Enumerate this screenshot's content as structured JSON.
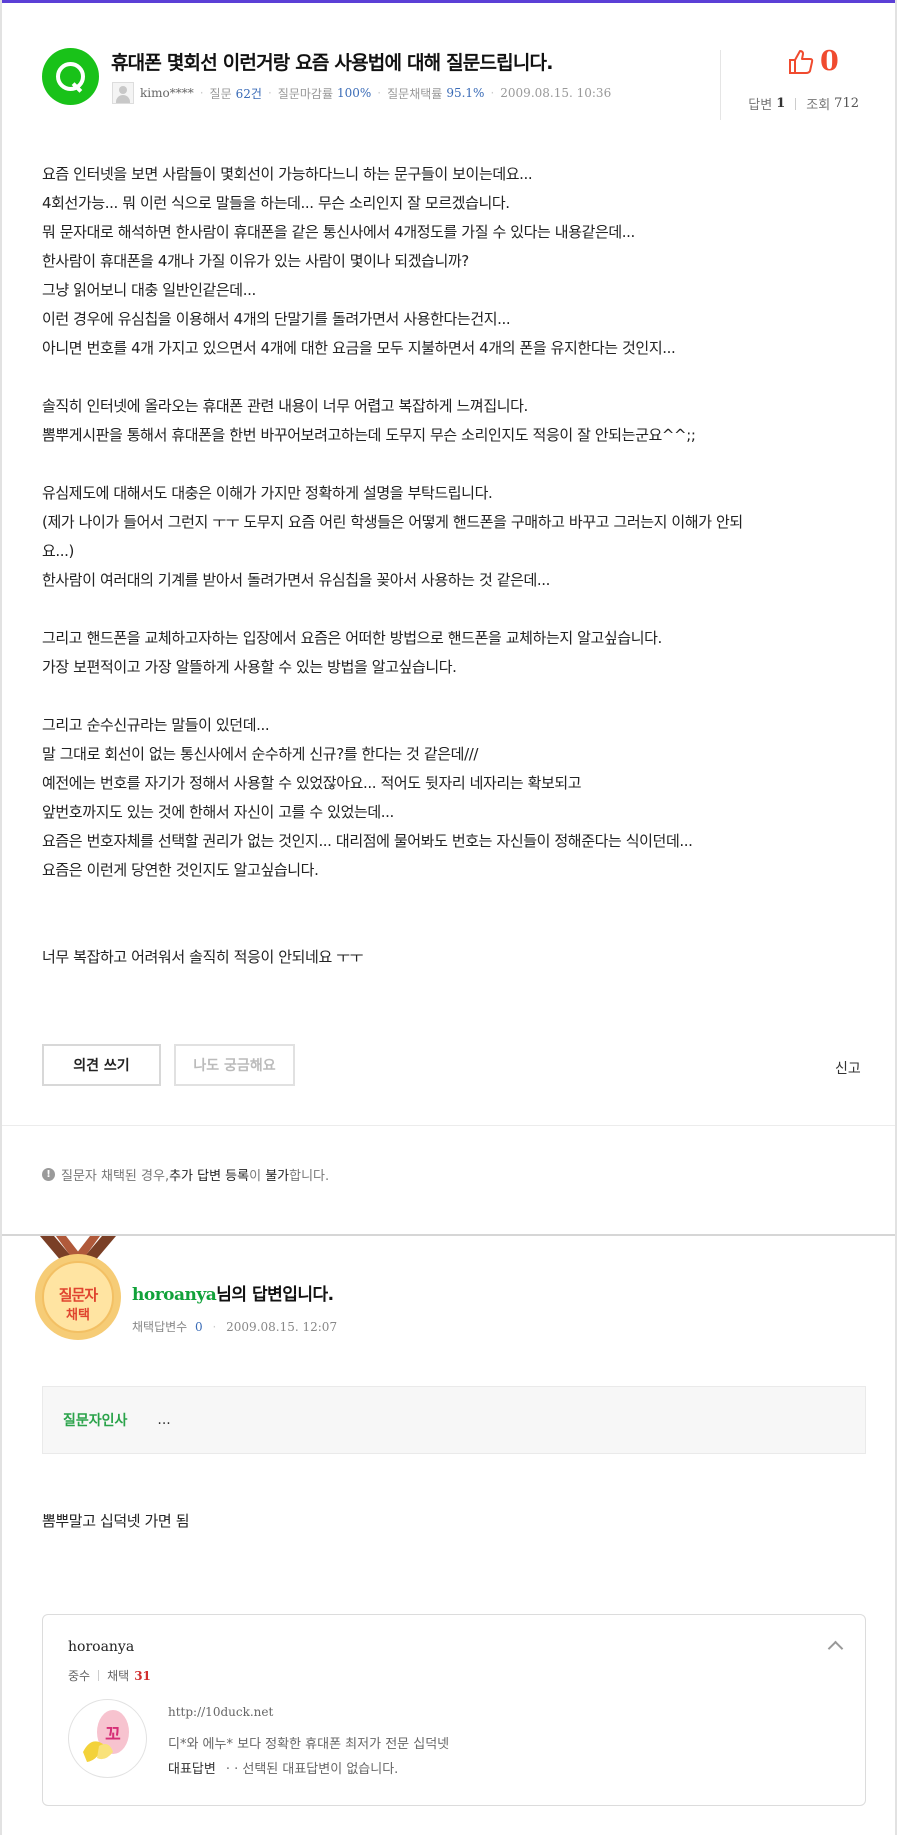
{
  "colors": {
    "accent_bar": "#5b3fd6",
    "like_red": "#f04b2f",
    "user_green": "#11a23a",
    "value_blue": "#3b6cb7"
  },
  "question": {
    "badge_icon": "q-icon",
    "title": "휴대폰 몇회선 이런거랑 요즘 사용법에 대해 질문드립니다.",
    "author": "kimo****",
    "meta": [
      {
        "label": "질문",
        "value": "62건"
      },
      {
        "label": "질문마감률",
        "value": "100%"
      },
      {
        "label": "질문채택률",
        "value": "95.1%"
      }
    ],
    "date": "2009.08.15. 10:36",
    "likes": "0",
    "answers_label": "답변",
    "answers_count": "1",
    "views_label": "조회",
    "views_count": "712",
    "body": [
      "요즘 인터넷을 보면 사람들이 몇회선이 가능하다느니 하는 문구들이 보이는데요...",
      "4회선가능... 뭐 이런 식으로 말들을 하는데... 무슨 소리인지 잘 모르겠습니다.",
      "뭐 문자대로 해석하면 한사람이 휴대폰을 같은 통신사에서 4개정도를 가질 수 있다는 내용같은데...",
      "한사람이 휴대폰을 4개나 가질 이유가 있는 사람이 몇이나 되겠습니까?",
      "그냥 읽어보니 대충 일반인같은데...",
      "이런 경우에 유심칩을 이용해서 4개의 단말기를 돌려가면서 사용한다는건지...",
      "아니면 번호를 4개 가지고 있으면서 4개에 대한 요금을 모두 지불하면서 4개의 폰을 유지한다는 것인지...",
      "",
      "솔직히 인터넷에 올라오는 휴대폰 관련 내용이 너무 어렵고 복잡하게 느껴집니다.",
      "뽐뿌게시판을 통해서 휴대폰을 한번 바꾸어보려고하는데 도무지 무슨 소리인지도 적응이 잘 안되는군요^^;;",
      "",
      "유심제도에 대해서도 대충은 이해가 가지만 정확하게 설명을 부탁드립니다.",
      "(제가 나이가 들어서 그런지 ㅜㅜ 도무지 요즘 어린 학생들은 어떻게 핸드폰을 구매하고 바꾸고 그러는지 이해가 안되",
      "요...)",
      "한사람이 여러대의 기계를 받아서 돌려가면서 유심칩을 꽂아서 사용하는 것 같은데...",
      "",
      "그리고 핸드폰을 교체하고자하는 입장에서 요즘은 어떠한 방법으로 핸드폰을 교체하는지 알고싶습니다.",
      "가장 보편적이고 가장 알뜰하게 사용할 수 있는 방법을 알고싶습니다.",
      "",
      "그리고 순수신규라는 말들이 있던데...",
      "말 그대로 회선이 없는 통신사에서 순수하게 신규?를 한다는 것 같은데///",
      "예전에는 번호를 자기가 정해서 사용할 수 있었잖아요... 적어도 뒷자리 네자리는 확보되고",
      "앞번호까지도 있는 것에 한해서 자신이 고를 수 있었는데...",
      "요즘은 번호자체를 선택할 권리가 없는 것인지... 대리점에 물어봐도 번호는 자신들이 정해준다는 식이던데...",
      "요즘은 이런게 당연한 것인지도 알고싶습니다.",
      "",
      "",
      "너무 복잡하고 어려워서 솔직히 적응이 안되네요 ㅜㅜ"
    ],
    "buttons": {
      "opinion": "의견 쓰기",
      "curious": "나도 궁금해요",
      "report": "신고"
    }
  },
  "notice": {
    "prefix": "질문자 채택된 경우, ",
    "strong1": "추가 답변 등록",
    "mid": "이 ",
    "strong2": "불가",
    "suffix": "합니다."
  },
  "answer": {
    "medal_line1": "질문자",
    "medal_line2": "채택",
    "username": "horoanya",
    "title_suffix": "님의 답변입니다.",
    "adopted_label": "채택답변수",
    "adopted_count": "0",
    "date": "2009.08.15. 12:07",
    "greeting_label": "질문자인사",
    "greeting_text": "...",
    "body": "뽐뿌말고 십덕넷 가면 됨",
    "profile": {
      "name": "horoanya",
      "rank": "중수",
      "adopt_label": "채택",
      "adopt_count": "31",
      "url": "http://10duck.net",
      "description": "디*와 에누* 보다 정확한 휴대폰 최저가 전문 십덕넷",
      "rep_label": "대표답변",
      "rep_text": "· · 선택된 대표답변이 없습니다.",
      "logo_text": "꼬"
    }
  }
}
